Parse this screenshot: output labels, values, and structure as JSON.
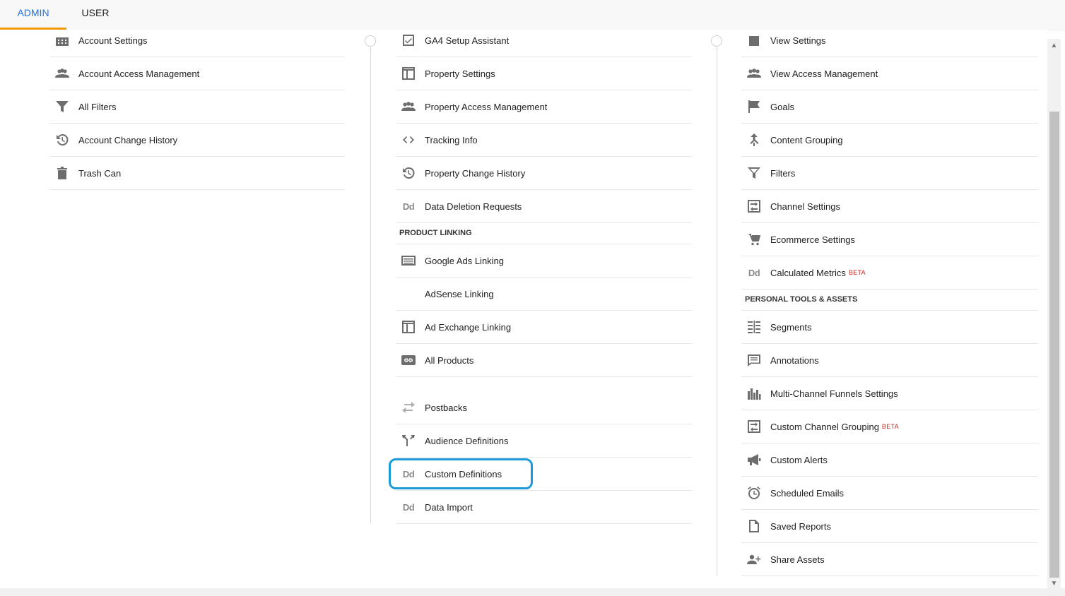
{
  "tabs": {
    "admin": "ADMIN",
    "user": "USER"
  },
  "account_column": {
    "items": [
      {
        "label": "Account Settings",
        "icon": "building-icon"
      },
      {
        "label": "Account Access Management",
        "icon": "people-icon"
      },
      {
        "label": "All Filters",
        "icon": "filter-icon"
      },
      {
        "label": "Account Change History",
        "icon": "history-icon"
      },
      {
        "label": "Trash Can",
        "icon": "trash-icon"
      }
    ]
  },
  "property_column": {
    "items": [
      {
        "label": "GA4 Setup Assistant",
        "icon": "checkbox-icon"
      },
      {
        "label": "Property Settings",
        "icon": "layout-icon"
      },
      {
        "label": "Property Access Management",
        "icon": "people-icon"
      },
      {
        "label": "Tracking Info",
        "icon": "code-icon"
      },
      {
        "label": "Property Change History",
        "icon": "history-icon"
      },
      {
        "label": "Data Deletion Requests",
        "icon": "dd-icon"
      }
    ],
    "product_linking_header": "PRODUCT LINKING",
    "linking_items": [
      {
        "label": "Google Ads Linking",
        "icon": "ads-icon"
      },
      {
        "label": "AdSense Linking",
        "icon": ""
      },
      {
        "label": "Ad Exchange Linking",
        "icon": "layout-icon"
      },
      {
        "label": "All Products",
        "icon": "link-icon"
      }
    ],
    "more_items": [
      {
        "label": "Postbacks",
        "icon": "swap-icon"
      },
      {
        "label": "Audience Definitions",
        "icon": "fork-icon"
      },
      {
        "label": "Custom Definitions",
        "icon": "dd-icon"
      },
      {
        "label": "Data Import",
        "icon": "dd-icon"
      }
    ]
  },
  "view_column": {
    "items": [
      {
        "label": "View Settings",
        "icon": "doc-icon"
      },
      {
        "label": "View Access Management",
        "icon": "people-icon"
      },
      {
        "label": "Goals",
        "icon": "flag-icon"
      },
      {
        "label": "Content Grouping",
        "icon": "merge-icon"
      },
      {
        "label": "Filters",
        "icon": "filter-icon"
      },
      {
        "label": "Channel Settings",
        "icon": "channel-icon"
      },
      {
        "label": "Ecommerce Settings",
        "icon": "cart-icon"
      },
      {
        "label": "Calculated Metrics",
        "icon": "dd-icon",
        "badge": "BETA"
      }
    ],
    "personal_header": "PERSONAL TOOLS & ASSETS",
    "personal_items": [
      {
        "label": "Segments",
        "icon": "segments-icon"
      },
      {
        "label": "Annotations",
        "icon": "comment-icon"
      },
      {
        "label": "Multi-Channel Funnels Settings",
        "icon": "bars-icon"
      },
      {
        "label": "Custom Channel Grouping",
        "icon": "channel-icon",
        "badge": "BETA"
      },
      {
        "label": "Custom Alerts",
        "icon": "megaphone-icon"
      },
      {
        "label": "Scheduled Emails",
        "icon": "alarm-icon"
      },
      {
        "label": "Saved Reports",
        "icon": "file-icon"
      },
      {
        "label": "Share Assets",
        "icon": "add-person-icon"
      }
    ]
  },
  "icon_text": {
    "dd": "Dd"
  },
  "colors": {
    "accent": "#1a73e8",
    "tab_underline": "#f29900",
    "highlight": "#1a9bd7",
    "beta": "#c5221f"
  }
}
